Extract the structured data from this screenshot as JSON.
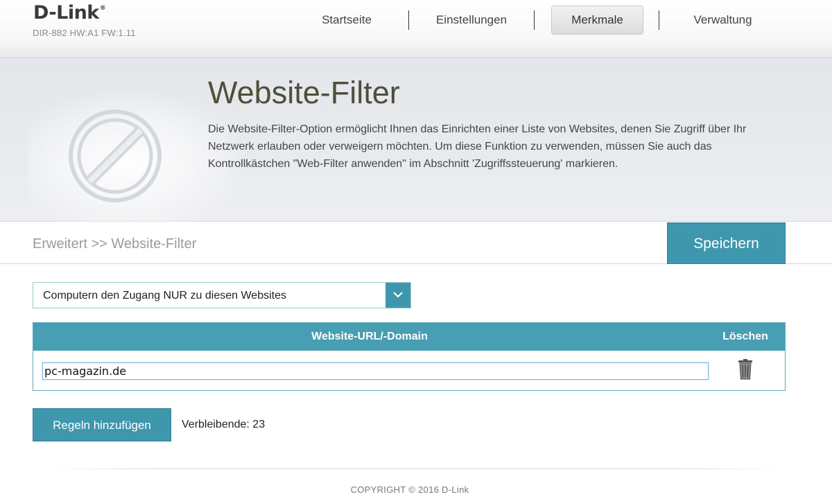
{
  "header": {
    "brand": "D-Link",
    "brand_mark": "®",
    "model": "DIR-882 HW:A1 FW:1.11",
    "tabs": [
      {
        "label": "Startseite",
        "active": false
      },
      {
        "label": "Einstellungen",
        "active": false
      },
      {
        "label": "Merkmale",
        "active": true
      },
      {
        "label": "Verwaltung",
        "active": false
      }
    ]
  },
  "banner": {
    "title": "Website-Filter",
    "description": "Die Website-Filter-Option ermöglicht Ihnen das Einrichten einer Liste von Websites, denen Sie Zugriff über Ihr Netzwerk erlauben oder verweigern möchten. Um diese Funktion zu verwenden, müssen Sie auch das Kontrollkästchen \"Web-Filter anwenden\" im Abschnitt 'Zugriffssteuerung' markieren.",
    "icon": "no-entry-icon"
  },
  "breadcrumb": "Erweitert >> Website-Filter",
  "save_label": "Speichern",
  "filter_mode": {
    "selected": "Computern den Zugang NUR zu diesen Websites",
    "icon": "chevron-down-icon"
  },
  "table": {
    "col_url": "Website-URL/-Domain",
    "col_delete": "Löschen",
    "rows": [
      {
        "url": "pc-magazin.de",
        "delete_icon": "trash-icon"
      }
    ]
  },
  "add_rules_label": "Regeln hinzufügen",
  "remaining": "Verbleibende: 23",
  "footer": {
    "copyright": "COPYRIGHT © 2016 D-Link"
  },
  "colors": {
    "accent": "#3f97ad",
    "table_header": "#489eb2",
    "title": "#4f4f3a"
  }
}
